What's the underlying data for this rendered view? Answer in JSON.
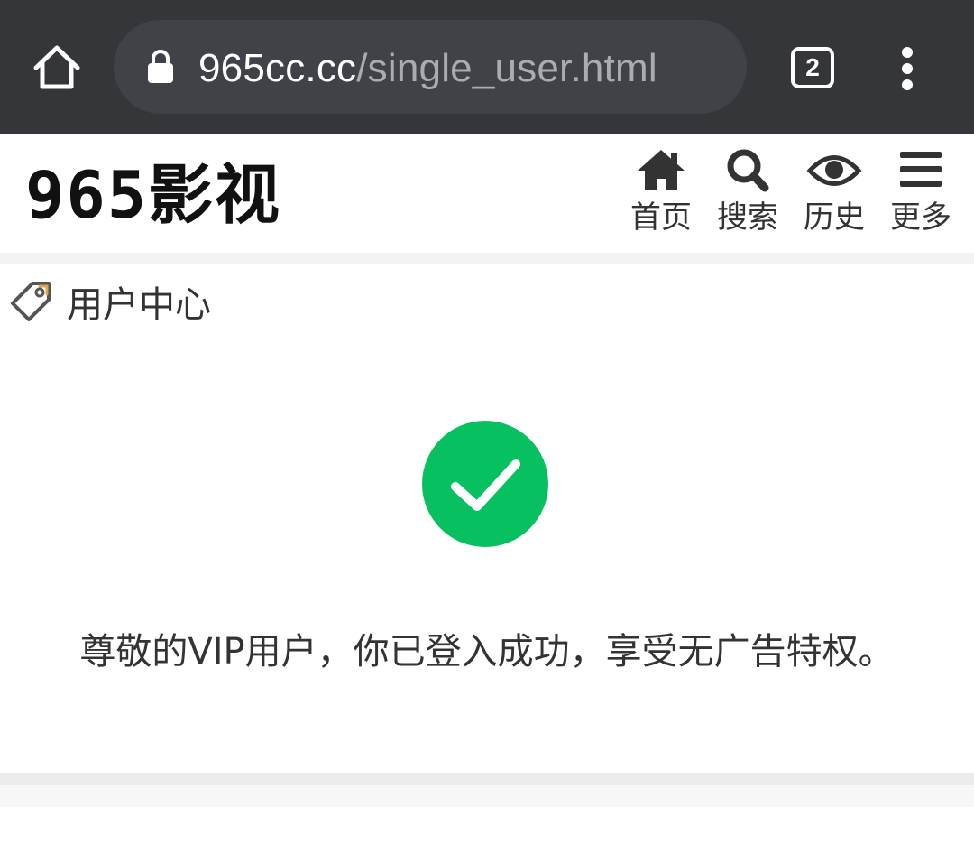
{
  "browser": {
    "url_host": "965cc.cc",
    "url_path": "/single_user.html",
    "tab_count": "2",
    "icons": {
      "home": "home-icon",
      "lock": "lock-icon",
      "menu": "more-vert-icon"
    }
  },
  "site": {
    "logo": "965影视",
    "nav": [
      {
        "label": "首页",
        "icon": "home-icon"
      },
      {
        "label": "搜索",
        "icon": "search-icon"
      },
      {
        "label": "历史",
        "icon": "eye-icon"
      },
      {
        "label": "更多",
        "icon": "menu-icon"
      }
    ]
  },
  "section": {
    "title": "用户中心",
    "icon": "tag-icon"
  },
  "status": {
    "icon": "success-check-icon",
    "color": "#07c160",
    "message": "尊敬的VIP用户，你已登入成功，享受无广告特权。"
  }
}
